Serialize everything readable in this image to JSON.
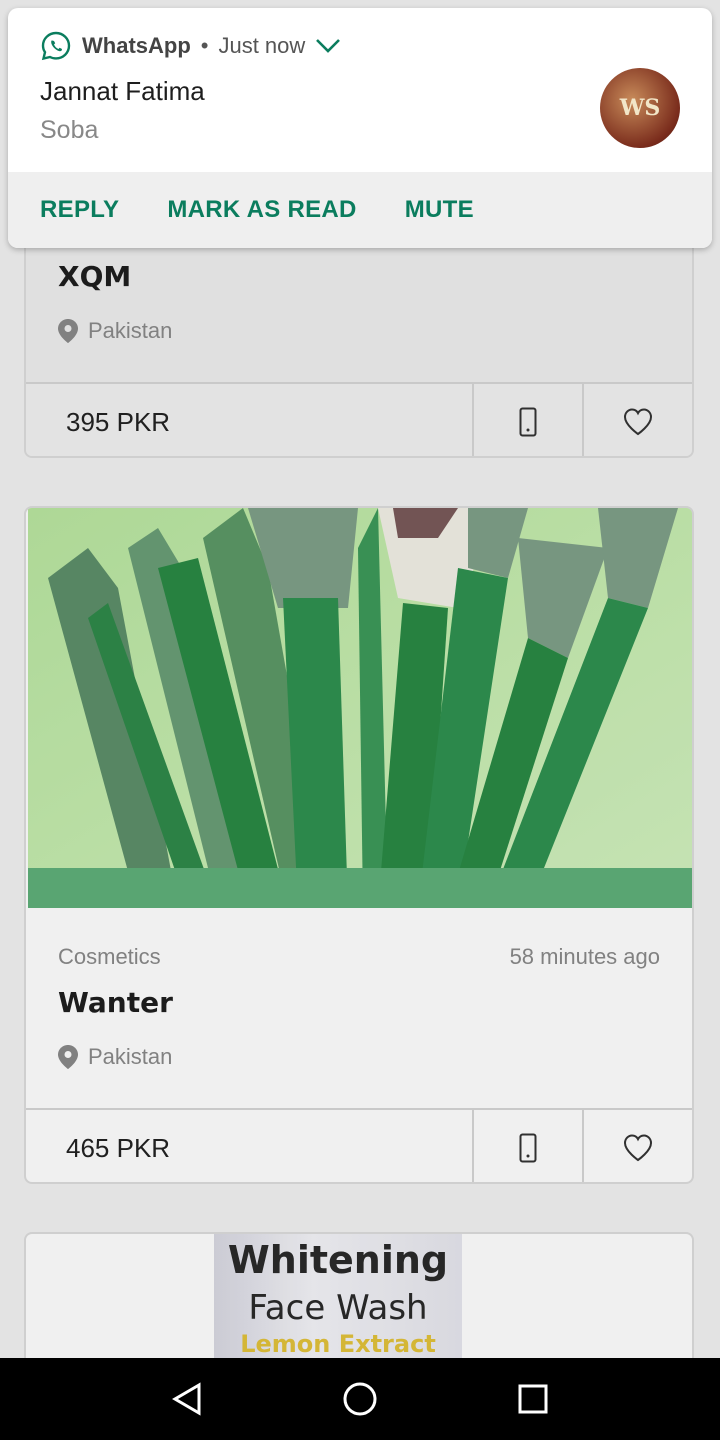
{
  "notification": {
    "app_name": "WhatsApp",
    "separator": "•",
    "time": "Just now",
    "sender": "Jannat Fatima",
    "message": "Soba",
    "avatar_text": "WS",
    "actions": [
      "REPLY",
      "MARK AS READ",
      "MUTE"
    ]
  },
  "listings": [
    {
      "title": "XQM",
      "location": "Pakistan",
      "price": "395 PKR"
    },
    {
      "category": "Cosmetics",
      "time": "58 minutes ago",
      "title": "Wanter",
      "location": "Pakistan",
      "price": "465 PKR"
    },
    {
      "image_text": [
        "Whitening",
        "Face Wash",
        "Lemon Extract"
      ]
    }
  ],
  "icons": {
    "phone": "phone-icon",
    "heart": "heart-icon",
    "pin": "location-pin-icon",
    "back": "back-icon",
    "home": "home-icon",
    "recents": "recents-icon"
  },
  "colors": {
    "whatsapp_green": "#0b7d5e",
    "background": "#f2f2f2"
  }
}
